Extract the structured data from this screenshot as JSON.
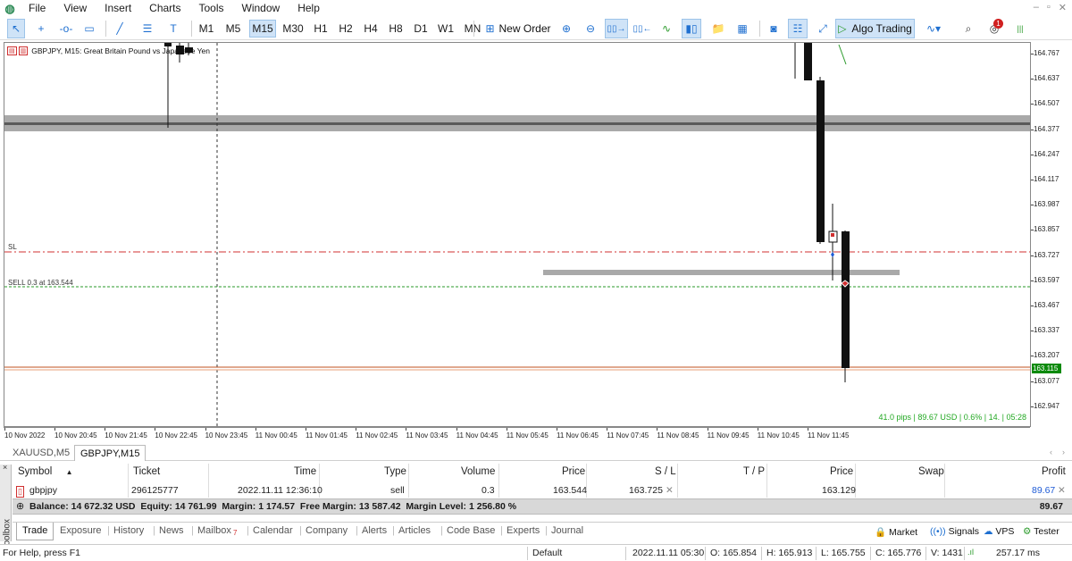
{
  "menu": [
    "File",
    "View",
    "Insert",
    "Charts",
    "Tools",
    "Window",
    "Help"
  ],
  "timeframes": [
    "M1",
    "M5",
    "M15",
    "M30",
    "H1",
    "H2",
    "H4",
    "H8",
    "D1",
    "W1",
    "MN"
  ],
  "active_timeframe": "M15",
  "toolbar": {
    "new_order": "New Order",
    "algo_trading": "Algo Trading",
    "alert_count": "1"
  },
  "chart": {
    "header": "GBPJPY, M15:  Great Britain Pound vs Japanese Yen",
    "sl_label": "SL",
    "sell_label": "SELL 0.3 at 163.544",
    "current_price": "163.115",
    "profit_info": "41.0 pips | 89.67 USD | 0.6% | 14. | 05:28",
    "price_labels": [
      "164.767",
      "164.637",
      "164.507",
      "164.377",
      "164.247",
      "164.117",
      "163.987",
      "163.857",
      "163.727",
      "163.597",
      "163.467",
      "163.337",
      "163.207",
      "163.077",
      "162.947"
    ],
    "time_labels": [
      "10 Nov 2022",
      "10 Nov 20:45",
      "10 Nov 21:45",
      "10 Nov 22:45",
      "10 Nov 23:45",
      "11 Nov 00:45",
      "11 Nov 01:45",
      "11 Nov 02:45",
      "11 Nov 03:45",
      "11 Nov 04:45",
      "11 Nov 05:45",
      "11 Nov 06:45",
      "11 Nov 07:45",
      "11 Nov 08:45",
      "11 Nov 09:45",
      "11 Nov 10:45",
      "11 Nov 11:45"
    ]
  },
  "chart_tabs": [
    "XAUUSD,M5",
    "GBPJPY,M15"
  ],
  "active_chart_tab": "GBPJPY,M15",
  "trade": {
    "headers": {
      "symbol": "Symbol",
      "ticket": "Ticket",
      "time": "Time",
      "type": "Type",
      "volume": "Volume",
      "price": "Price",
      "sl": "S / L",
      "tp": "T / P",
      "price2": "Price",
      "swap": "Swap",
      "profit": "Profit"
    },
    "row": {
      "symbol": "gbpjpy",
      "ticket": "296125777",
      "time": "2022.11.11 12:36:10",
      "type": "sell",
      "volume": "0.3",
      "price": "163.544",
      "sl": "163.725",
      "price2": "163.129",
      "profit": "89.67"
    },
    "balance_line": "Balance: 14 672.32 USD  Equity: 14 761.99  Margin: 1 174.57  Free Margin: 13 587.42  Margin Level: 1 256.80 %",
    "balance_profit": "89.67"
  },
  "toolbox_label": "Toolbox",
  "bottom_tabs": [
    "Trade",
    "Exposure",
    "History",
    "News",
    "Mailbox",
    "Calendar",
    "Company",
    "Alerts",
    "Articles",
    "Code Base",
    "Experts",
    "Journal"
  ],
  "mailbox_badge": "7",
  "bottom_right": {
    "market": "Market",
    "signals": "Signals",
    "vps": "VPS",
    "tester": "Tester"
  },
  "status": {
    "help": "For Help, press F1",
    "profile": "Default",
    "datetime": "2022.11.11 05:30",
    "open": "O: 165.854",
    "high": "H: 165.913",
    "low": "L: 165.755",
    "close": "C: 165.776",
    "volume": "V: 1431",
    "ping": "257.17 ms"
  },
  "colors": {
    "buy_profit": "#1e5bd6",
    "pips_green": "#22a822",
    "sl_red": "#d03030",
    "sell_green": "#2a9a2a",
    "price_line": "#c0501f",
    "bid_box": "#0b8a0b"
  }
}
